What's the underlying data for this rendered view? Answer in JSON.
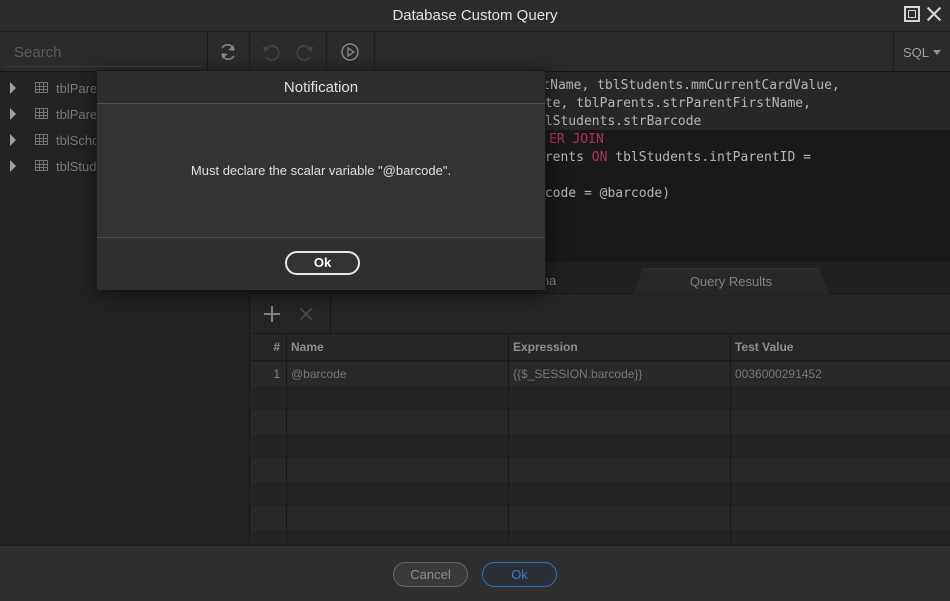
{
  "window": {
    "title": "Database Custom Query"
  },
  "toolbar": {
    "search_placeholder": "Search",
    "language": "SQL"
  },
  "tree": {
    "items": [
      "tblPare",
      "tblPare",
      "tblScho",
      "tblStud"
    ]
  },
  "editor": {
    "lines": [
      {
        "text": "udentName, tblStudents.mmCurrentCardValue,"
      },
      {
        "text": "ate, tblParents.strParentFirstName,"
      },
      {
        "text": "blStudents.strBarcode"
      },
      {
        "text": "ER JOIN"
      },
      {
        "text": "arents ON tblStudents.intParentID ="
      },
      {
        "text": ""
      },
      {
        "text": "rcode = @barcode)"
      }
    ]
  },
  "tabs": {
    "schema": "ema",
    "results": "Query Results"
  },
  "params": {
    "headers": {
      "num": "#",
      "name": "Name",
      "expression": "Expression",
      "test": "Test Value"
    },
    "rows": [
      {
        "num": "1",
        "name": "@barcode",
        "expression": "{{$_SESSION.barcode}}",
        "test": "0036000291452"
      }
    ]
  },
  "footer": {
    "cancel": "Cancel",
    "ok": "Ok"
  },
  "modal": {
    "title": "Notification",
    "message": "Must declare the scalar variable \"@barcode\".",
    "ok": "Ok"
  },
  "colors": {
    "accent": "#2d6fb5",
    "keyword": "#d23a6a"
  }
}
